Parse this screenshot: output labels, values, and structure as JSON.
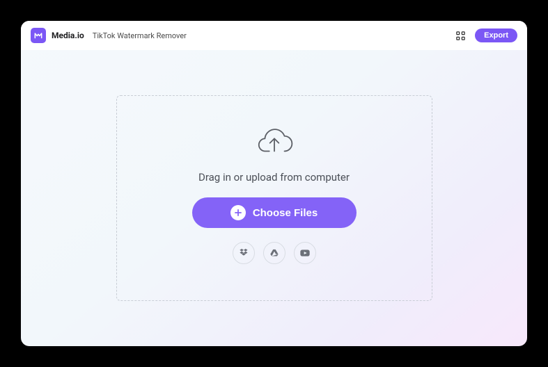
{
  "header": {
    "brand": "Media.io",
    "page_title": "TikTok Watermark Remover",
    "export_label": "Export"
  },
  "dropzone": {
    "instruction": "Drag in or upload from computer",
    "choose_label": "Choose Files",
    "sources": [
      {
        "name": "dropbox"
      },
      {
        "name": "google-drive"
      },
      {
        "name": "youtube"
      }
    ]
  },
  "colors": {
    "accent": "#8463f7"
  }
}
